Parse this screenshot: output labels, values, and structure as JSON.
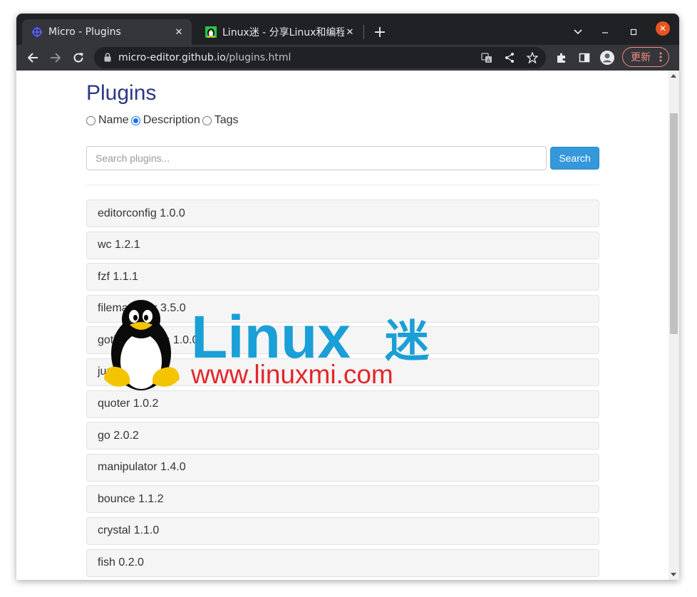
{
  "browser": {
    "tabs": [
      {
        "title": "Micro - Plugins",
        "active": true,
        "favicon": "micro-favicon"
      },
      {
        "title": "Linux迷 - 分享Linux和编程",
        "active": false,
        "favicon": "penguin-favicon"
      }
    ],
    "url_host": "micro-editor.github.io",
    "url_path": "/plugins.html",
    "update_label": "更新",
    "colors": {
      "frame": "#202124",
      "toolbar": "#35363a",
      "close": "#e95420",
      "update": "#f28b82"
    }
  },
  "page": {
    "title": "Plugins",
    "radios": [
      {
        "label": "Name",
        "checked": false
      },
      {
        "label": "Description",
        "checked": true
      },
      {
        "label": "Tags",
        "checked": false
      }
    ],
    "search": {
      "placeholder": "Search plugins...",
      "value": "",
      "button_label": "Search"
    },
    "plugins": [
      "editorconfig 1.0.0",
      "wc 1.2.1",
      "fzf 1.1.1",
      "filemanager 3.5.0",
      "gotham-colors 1.0.0",
      "jump 1.0.0",
      "quoter 1.0.2",
      "go 2.0.2",
      "manipulator 1.4.0",
      "bounce 1.1.2",
      "crystal 1.1.0",
      "fish 0.2.0"
    ],
    "colors": {
      "heading": "#2c3784",
      "button": "#3498db"
    }
  },
  "watermark": {
    "brand": "Linux",
    "brand_suffix": "迷",
    "site": "www.linuxmi.com",
    "colors": {
      "brand": "#1a9fd6",
      "site": "#e5262a"
    }
  }
}
